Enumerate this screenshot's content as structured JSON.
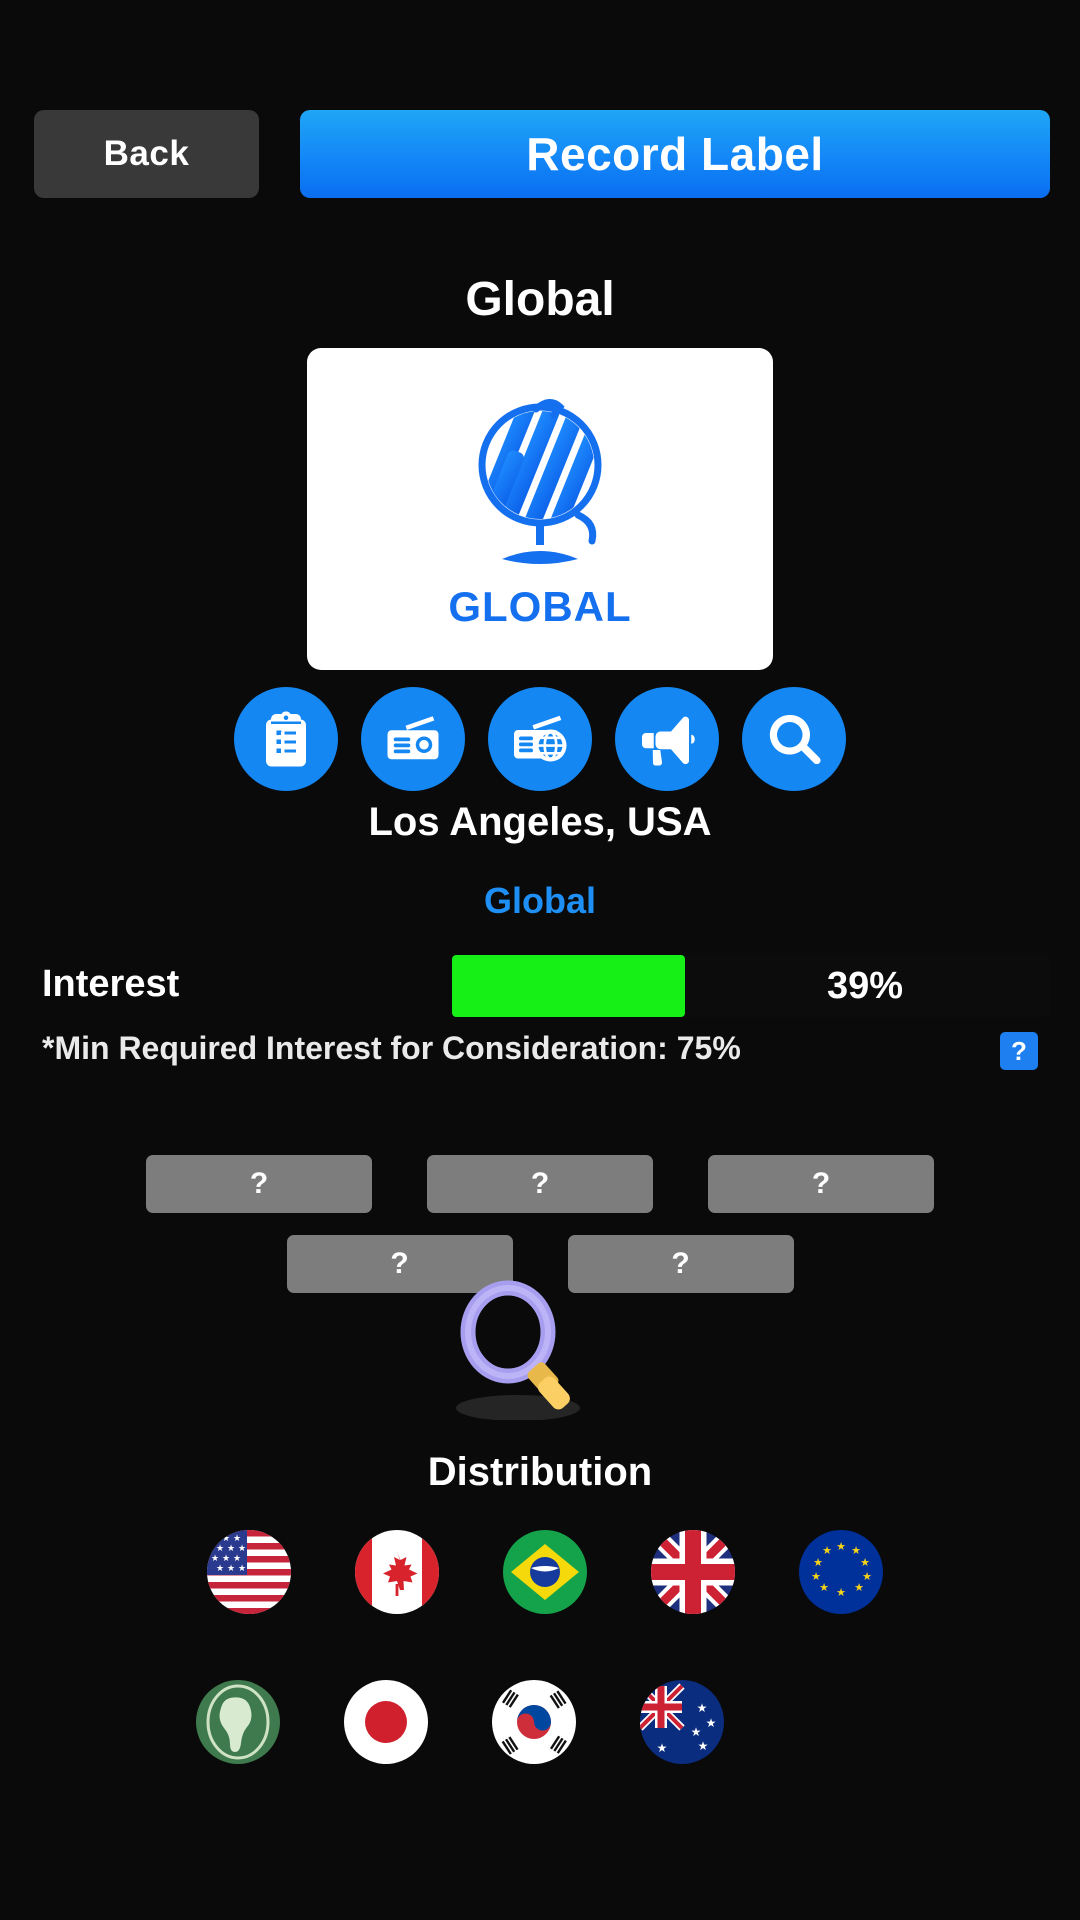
{
  "header": {
    "back_label": "Back",
    "title_label": "Record Label"
  },
  "label": {
    "name": "Global",
    "logo_word": "GLOBAL",
    "location": "Los Angeles, USA",
    "genre": "Global"
  },
  "action_icons": [
    {
      "name": "clipboard-checklist-icon",
      "label": "Contract"
    },
    {
      "name": "radio-icon",
      "label": "Radio"
    },
    {
      "name": "radio-globe-icon",
      "label": "International Radio"
    },
    {
      "name": "megaphone-icon",
      "label": "Promotion"
    },
    {
      "name": "search-icon",
      "label": "Search"
    }
  ],
  "interest": {
    "label": "Interest",
    "value_text": "39%",
    "percent": 39,
    "bar_color": "#17f017",
    "min_note": "*Min Required Interest for Consideration: 75%",
    "min_required_percent": 75,
    "help_badge": "?"
  },
  "slots": {
    "row1": [
      "?",
      "?",
      "?"
    ],
    "row2": [
      "?",
      "?"
    ]
  },
  "distribution": {
    "title": "Distribution",
    "row1": [
      {
        "name": "flag-usa",
        "label": "United States"
      },
      {
        "name": "flag-canada",
        "label": "Canada"
      },
      {
        "name": "flag-brazil",
        "label": "Brazil"
      },
      {
        "name": "flag-uk",
        "label": "United Kingdom"
      },
      {
        "name": "flag-eu",
        "label": "European Union"
      }
    ],
    "row2": [
      {
        "name": "flag-africa",
        "label": "Africa"
      },
      {
        "name": "flag-japan",
        "label": "Japan"
      },
      {
        "name": "flag-south-korea",
        "label": "South Korea"
      },
      {
        "name": "flag-australia",
        "label": "Australia"
      }
    ]
  },
  "colors": {
    "background": "#0a0a0a",
    "accent_blue": "#1487f3",
    "title_gradient_top": "#1fa6f5",
    "title_gradient_bottom": "#0a6ef0",
    "interest_green": "#17f017",
    "slot_gray": "#7d7d7d",
    "back_gray": "#393939",
    "genre_blue": "#1e90f5"
  }
}
